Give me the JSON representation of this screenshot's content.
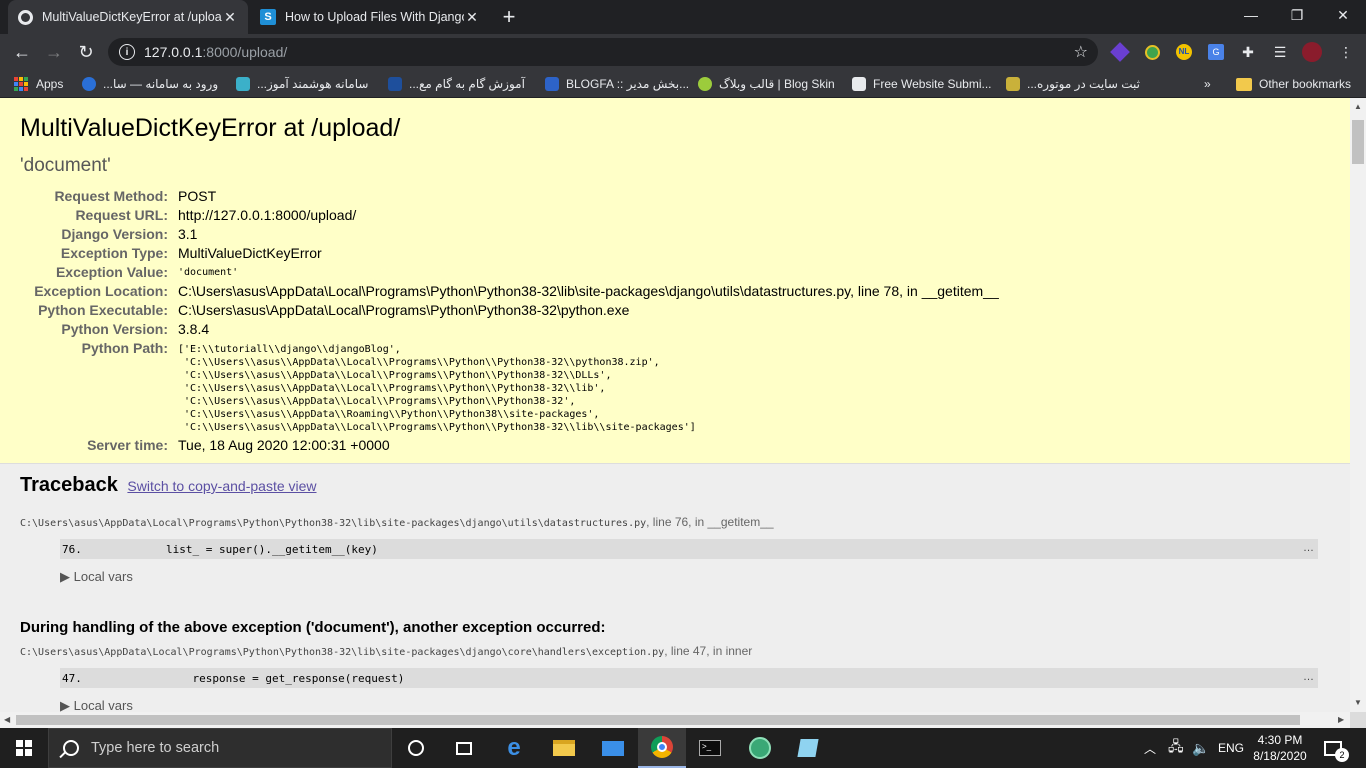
{
  "browser": {
    "tabs": [
      {
        "title": "MultiValueDictKeyError at /upload/",
        "active": true
      },
      {
        "title": "How to Upload Files With Django",
        "active": false
      }
    ],
    "url": "127.0.0.1:8000/upload/",
    "url_host": "127.0.0.1",
    "url_rest": ":8000/upload/",
    "bookmarks": [
      {
        "label": "Apps"
      },
      {
        "label": "ورود به سامانه — سا..."
      },
      {
        "label": "سامانه هوشمند آموز..."
      },
      {
        "label": "آموزش گام به گام مع..."
      },
      {
        "label": "BLOGFA :: بخش مدیر..."
      },
      {
        "label": "قالب وبلاگ | Blog Skin"
      },
      {
        "label": "Free Website Submi..."
      },
      {
        "label": "ثبت سایت در موتوره..."
      }
    ],
    "bookmarks_overflow": "»",
    "other_bookmarks": "Other bookmarks"
  },
  "error": {
    "title": "MultiValueDictKeyError at /upload/",
    "subtitle": "'document'",
    "meta": [
      {
        "label": "Request Method:",
        "value": "POST"
      },
      {
        "label": "Request URL:",
        "value": "http://127.0.0.1:8000/upload/"
      },
      {
        "label": "Django Version:",
        "value": "3.1"
      },
      {
        "label": "Exception Type:",
        "value": "MultiValueDictKeyError"
      },
      {
        "label": "Exception Value:",
        "value": "'document'"
      },
      {
        "label": "Exception Location:",
        "value": "C:\\Users\\asus\\AppData\\Local\\Programs\\Python\\Python38-32\\lib\\site-packages\\django\\utils\\datastructures.py, line 78, in __getitem__"
      },
      {
        "label": "Python Executable:",
        "value": "C:\\Users\\asus\\AppData\\Local\\Programs\\Python\\Python38-32\\python.exe"
      },
      {
        "label": "Python Version:",
        "value": "3.8.4"
      },
      {
        "label": "Python Path:",
        "value": ""
      },
      {
        "label": "Server time:",
        "value": "Tue, 18 Aug 2020 12:00:31 +0000"
      }
    ],
    "python_path": [
      "['E:\\\\tutoriall\\\\django\\\\djangoBlog',",
      " 'C:\\\\Users\\\\asus\\\\AppData\\\\Local\\\\Programs\\\\Python\\\\Python38-32\\\\python38.zip',",
      " 'C:\\\\Users\\\\asus\\\\AppData\\\\Local\\\\Programs\\\\Python\\\\Python38-32\\\\DLLs',",
      " 'C:\\\\Users\\\\asus\\\\AppData\\\\Local\\\\Programs\\\\Python\\\\Python38-32\\\\lib',",
      " 'C:\\\\Users\\\\asus\\\\AppData\\\\Local\\\\Programs\\\\Python\\\\Python38-32',",
      " 'C:\\\\Users\\\\asus\\\\AppData\\\\Roaming\\\\Python\\\\Python38\\\\site-packages',",
      " 'C:\\\\Users\\\\asus\\\\AppData\\\\Local\\\\Programs\\\\Python\\\\Python38-32\\\\lib\\\\site-packages']"
    ]
  },
  "traceback": {
    "heading": "Traceback",
    "switch_link": "Switch to copy-and-paste view",
    "frames": [
      {
        "path": "C:\\Users\\asus\\AppData\\Local\\Programs\\Python\\Python38-32\\lib\\site-packages\\django\\utils\\datastructures.py",
        "location": ", line 76, in __getitem__",
        "lineno": "76.",
        "code": "list_ = super().__getitem__(key)",
        "local_vars": "▶ Local vars"
      },
      {
        "path": "C:\\Users\\asus\\AppData\\Local\\Programs\\Python\\Python38-32\\lib\\site-packages\\django\\core\\handlers\\exception.py",
        "location": ", line 47, in inner",
        "lineno": "47.",
        "code": "    response = get_response(request)",
        "local_vars": "▶ Local vars"
      }
    ],
    "during": "During handling of the above exception ('document'), another exception occurred:",
    "ellipsis": "…"
  },
  "taskbar": {
    "search_placeholder": "Type here to search",
    "language": "ENG",
    "time": "4:30 PM",
    "date": "8/18/2020",
    "notification_count": "2"
  },
  "colors": {
    "summary_bg": "#ffffc8",
    "page_bg": "#eeeeee",
    "chrome_dark": "#202124",
    "chrome_toolbar": "#35363a",
    "link": "#5b4fa3"
  }
}
